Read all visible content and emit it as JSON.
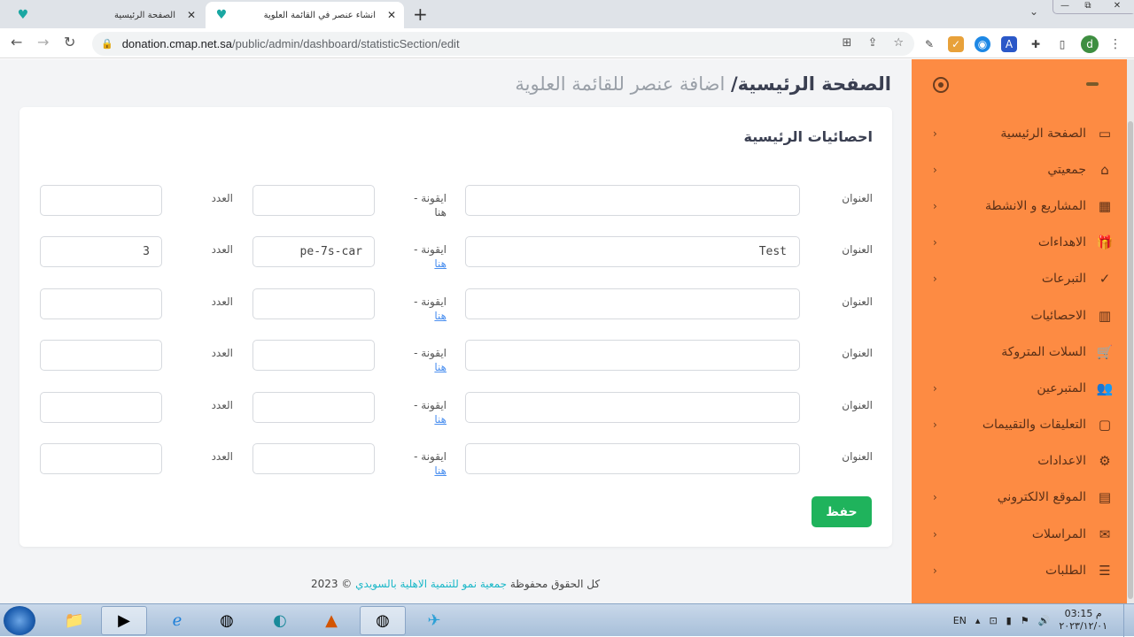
{
  "browser": {
    "tabs": [
      {
        "title": "الصفحة الرئيسية",
        "close": "✕"
      },
      {
        "title": "انشاء عنصر في القائمة العلوية",
        "close": "✕"
      }
    ],
    "new_tab": "+",
    "window_controls": {
      "minimize": "—",
      "restore": "⧉",
      "close": "✕"
    },
    "url_host": "donation.cmap.net.sa",
    "url_path": "/public/admin/dashboard/statisticSection/edit",
    "profile_initial": "d"
  },
  "page": {
    "breadcrumb_home": "الصفحة الرئيسية/",
    "breadcrumb_current": " اضافة عنصر للقائمة العلوية",
    "card_title": "احصائيات الرئيسية",
    "labels": {
      "title": "العنوان",
      "icon": "ايقونة -",
      "here": "هنا",
      "count": "العدد"
    },
    "rows": [
      {
        "title": "",
        "icon": "",
        "count": "",
        "show_link": false
      },
      {
        "title": "Test",
        "icon": "pe-7s-car",
        "count": "3",
        "show_link": true
      },
      {
        "title": "",
        "icon": "",
        "count": "",
        "show_link": true
      },
      {
        "title": "",
        "icon": "",
        "count": "",
        "show_link": true
      },
      {
        "title": "",
        "icon": "",
        "count": "",
        "show_link": true
      },
      {
        "title": "",
        "icon": "",
        "count": "",
        "show_link": true
      }
    ],
    "save_label": "حفظ",
    "footer_prefix": "كل الحقوق محفوظة ",
    "footer_org": "جمعية نمو للتنمية الاهلية بالسويدي",
    "footer_suffix": " © 2023"
  },
  "sidebar": {
    "accent_color": "#fd8b43",
    "items": [
      {
        "label": "الصفحة الرئيسية",
        "icon": "monitor-icon",
        "chevron": true
      },
      {
        "label": "جمعيتي",
        "icon": "inbox-icon",
        "chevron": true
      },
      {
        "label": "المشاريع و الانشطة",
        "icon": "grid-icon",
        "chevron": true
      },
      {
        "label": "الاهداءات",
        "icon": "gift-icon",
        "chevron": true
      },
      {
        "label": "التبرعات",
        "icon": "check-circle-icon",
        "chevron": true
      },
      {
        "label": "الاحصائيات",
        "icon": "bar-chart-icon",
        "chevron": false
      },
      {
        "label": "السلات المتروكة",
        "icon": "cart-x-icon",
        "chevron": false
      },
      {
        "label": "المتبرعين",
        "icon": "users-icon",
        "chevron": true
      },
      {
        "label": "التعليقات والتقييمات",
        "icon": "comments-icon",
        "chevron": true
      },
      {
        "label": "الاعدادات",
        "icon": "gear-icon",
        "chevron": false
      },
      {
        "label": "الموقع الالكتروني",
        "icon": "window-icon",
        "chevron": true
      },
      {
        "label": "المراسلات",
        "icon": "message-icon",
        "chevron": true
      },
      {
        "label": "الطلبات",
        "icon": "list-icon",
        "chevron": true
      }
    ]
  },
  "taskbar": {
    "language": "EN",
    "time": "03:15 م",
    "date": "٢٠٢٣/١٢/٠١"
  }
}
